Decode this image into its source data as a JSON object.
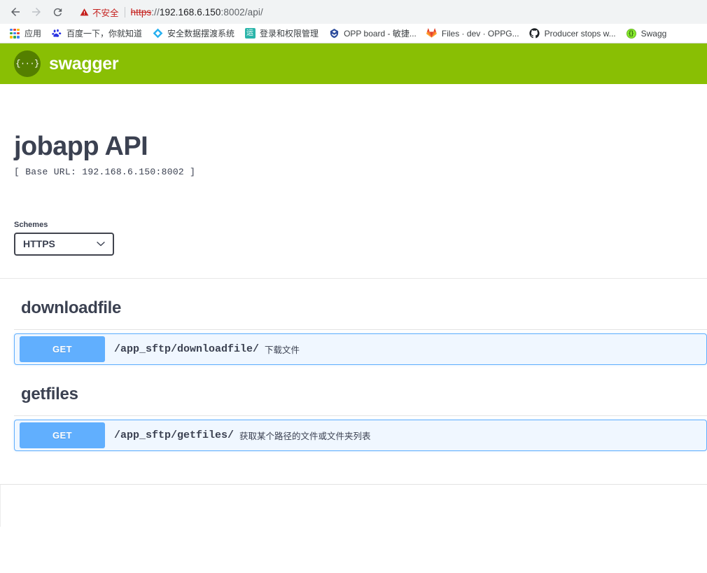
{
  "browser": {
    "nav": {
      "back_label": "Back",
      "forward_label": "Forward",
      "reload_label": "Reload"
    },
    "omnibox": {
      "security_label": "不安全",
      "url_scheme": "https",
      "url_separator": "://",
      "url_host": "192.168.6.150",
      "url_rest": ":8002/api/",
      "full_url": "https://192.168.6.150:8002/api/"
    },
    "bookmarks": [
      {
        "label": "应用",
        "icon": "apps-grid-icon"
      },
      {
        "label": "百度一下，你就知道",
        "icon": "baidu-paw-icon"
      },
      {
        "label": "安全数据摆渡系统",
        "icon": "diamond-icon"
      },
      {
        "label": "登录和权限管理",
        "icon": "yun-square-icon",
        "icon_text": "运"
      },
      {
        "label": "OPP board - 敏捷...",
        "icon": "jira-icon"
      },
      {
        "label": "Files · dev · OPPG...",
        "icon": "gitlab-fox-icon"
      },
      {
        "label": "Producer stops w...",
        "icon": "github-icon"
      },
      {
        "label": "Swagg",
        "icon": "swagger-circle-icon",
        "icon_text": "{}"
      }
    ]
  },
  "swagger": {
    "brand": "swagger",
    "logo_glyph": "{···}",
    "brand_color": "#89bf04",
    "logo_color": "#547f00",
    "method_color": "#61affe",
    "api_title": "jobapp API",
    "base_url_line": "[ Base URL: 192.168.6.150:8002 ]",
    "schemes": {
      "label": "Schemes",
      "selected": "HTTPS",
      "options": [
        "HTTPS"
      ]
    },
    "groups": [
      {
        "name": "downloadfile",
        "operations": [
          {
            "method": "GET",
            "path": "/app_sftp/downloadfile/",
            "summary": "下载文件"
          }
        ]
      },
      {
        "name": "getfiles",
        "operations": [
          {
            "method": "GET",
            "path": "/app_sftp/getfiles/",
            "summary": "获取某个路径的文件或文件夹列表"
          }
        ]
      }
    ]
  }
}
